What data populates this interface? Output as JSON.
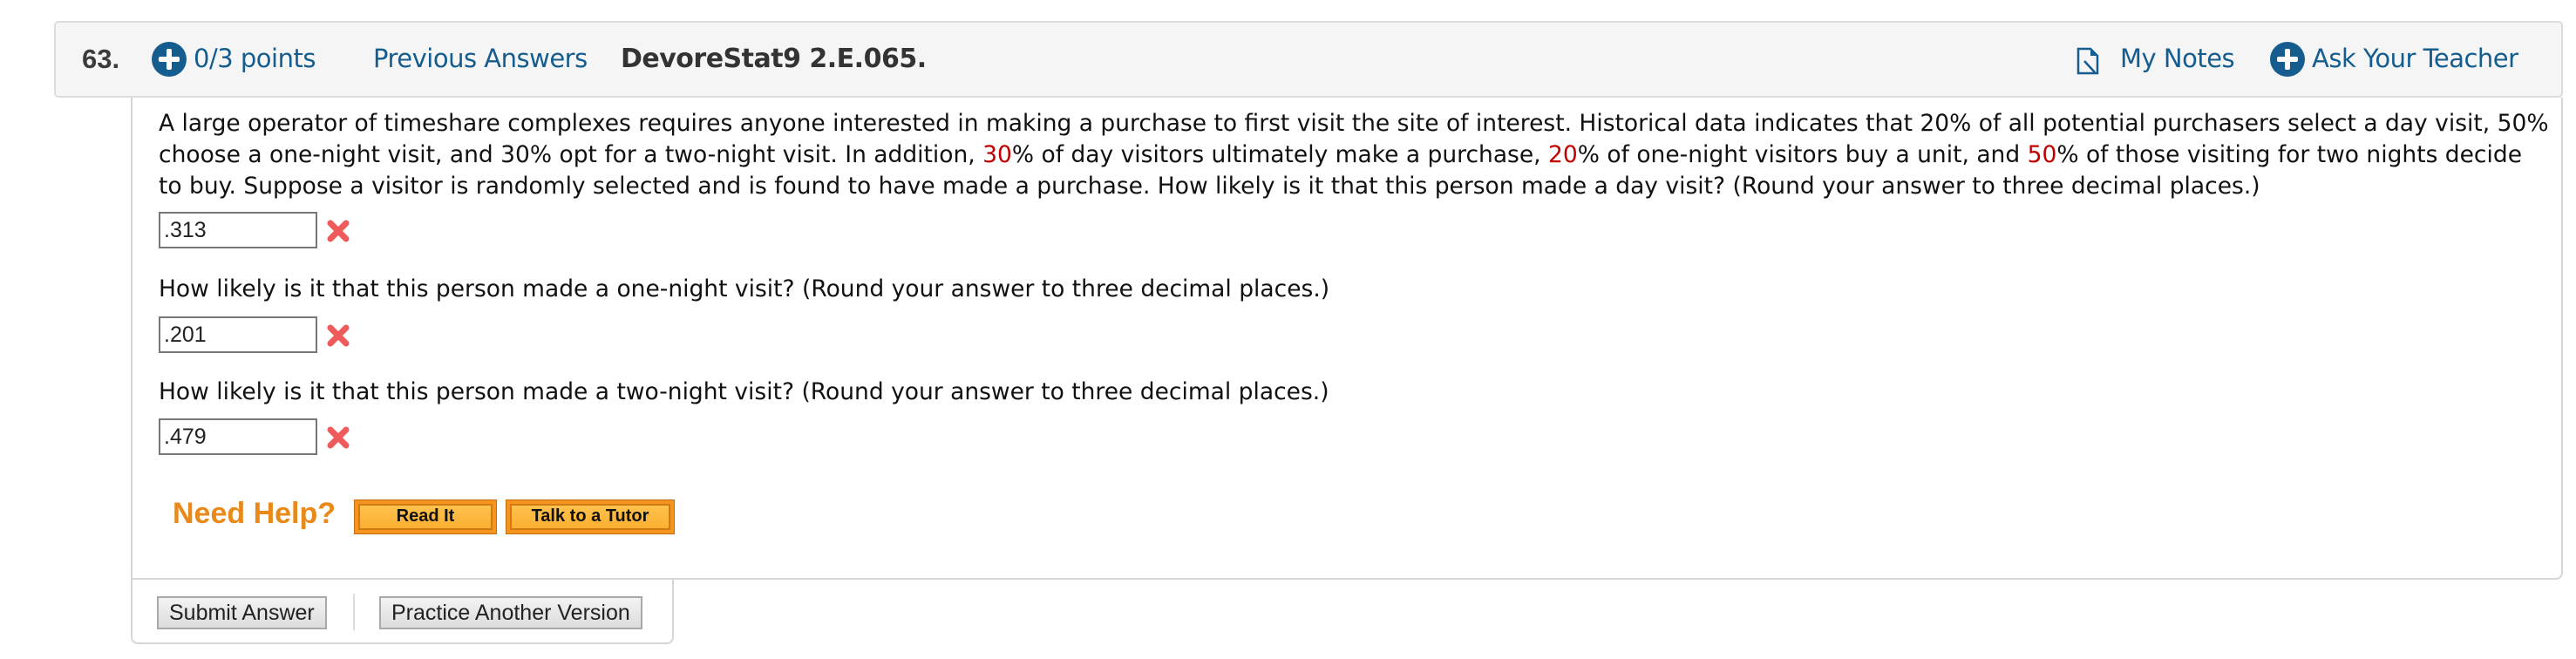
{
  "header": {
    "question_number": "63.",
    "points": "0/3 points",
    "previous_answers": "Previous Answers",
    "question_id": "DevoreStat9 2.E.065.",
    "my_notes": "My Notes",
    "ask_teacher": "Ask Your Teacher",
    "accent_color": "#155d8e"
  },
  "question": {
    "intro_lines": [
      "A large operator of timeshare complexes requires anyone interested in making a purchase to first visit the site of interest. Historical data indicates that 20% of all potential purchasers select a day visit, 50%",
      [
        "choose a one-night visit, and 30% opt for a two-night visit. In addition, ",
        "30",
        "% of day visitors ultimately make a purchase, ",
        "20",
        "% of one-night visitors buy a unit, and ",
        "50",
        "% of those visiting for two nights decide"
      ],
      "to buy. Suppose a visitor is randomly selected and is found to have made a purchase. How likely is it that this person made a day visit? (Round your answer to three decimal places.)"
    ],
    "line2": {
      "a": "choose a one-night visit, and 30% opt for a two-night visit. In addition, ",
      "v1": "30",
      "b": "% of day visitors ultimately make a purchase, ",
      "v2": "20",
      "c": "% of one-night visitors buy a unit, and ",
      "v3": "50",
      "d": "% of those visiting for two nights decide"
    },
    "parts": [
      {
        "prompt": "",
        "answer": ".313",
        "status": "incorrect"
      },
      {
        "prompt": "How likely is it that this person made a one-night visit? (Round your answer to three decimal places.)",
        "answer": ".201",
        "status": "incorrect"
      },
      {
        "prompt": "How likely is it that this person made a two-night visit? (Round your answer to three decimal places.)",
        "answer": ".479",
        "status": "incorrect"
      }
    ]
  },
  "help": {
    "label": "Need Help?",
    "read_it": "Read It",
    "talk_to_tutor": "Talk to a Tutor"
  },
  "footer": {
    "submit": "Submit Answer",
    "practice": "Practice Another Version"
  }
}
